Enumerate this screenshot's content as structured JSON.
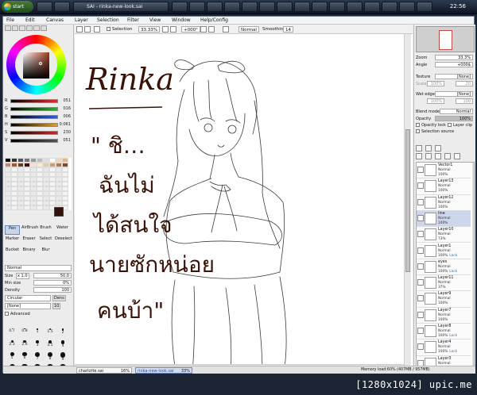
{
  "taskbar": {
    "start_label": "start",
    "active_window": "SAI - rinka-new-look.sai",
    "clock": "22:56"
  },
  "app_title": "SAI",
  "menu": [
    "File",
    "Edit",
    "Canvas",
    "Layer",
    "Selection",
    "Filter",
    "View",
    "Window",
    "Help/Config"
  ],
  "canvas_toolbar": {
    "selection_label": "Selection",
    "zoom": "33.33%",
    "rotation": "+000°",
    "mode": "Normal",
    "smoothing_label": "Smoothing",
    "smoothing": "14"
  },
  "color_sliders": [
    {
      "label": "R",
      "value": "051",
      "color": "#e03030"
    },
    {
      "label": "G",
      "value": "016",
      "color": "#30b030"
    },
    {
      "label": "B",
      "value": "006",
      "color": "#3060e0"
    },
    {
      "label": "H",
      "value": "0:061",
      "color": "#e0a030"
    },
    {
      "label": "S",
      "value": "230",
      "color": "#c03030"
    },
    {
      "label": "V",
      "value": "051",
      "color": "#555555"
    }
  ],
  "fg_color": "#33100a",
  "tools": [
    "Pen",
    "AirBrush",
    "Brush",
    "Water",
    "Marker",
    "Eraser",
    "Select",
    "Deselect",
    "Bucket",
    "Binary",
    "Blur"
  ],
  "selected_tool": "Pen",
  "tool_settings": {
    "mode": "Normal",
    "size_label": "Size",
    "size_mult": "x 1.0",
    "size": "50.0",
    "min_size_label": "Min size",
    "min_size": "0%",
    "density_label": "Density",
    "density": "100",
    "shape": "Circular",
    "shape_value": "Dens",
    "shape_value2": "10",
    "texture": "[None]",
    "advanced_label": "Advanced"
  },
  "brush_sizes": [
    "0.7",
    "0.8",
    "1",
    "1.5",
    "2",
    "2.3",
    "2.6",
    "3",
    "3.5",
    "4",
    "5",
    "6",
    "7",
    "8",
    "9",
    "10",
    "12",
    "14",
    "16",
    "20",
    "25",
    "30",
    "35",
    "40",
    "50"
  ],
  "navigator": {
    "zoom_label": "Zoom",
    "zoom": "33.3%",
    "angle_label": "Angle",
    "angle": "+000$"
  },
  "texture_panel": {
    "texture_label": "Texture",
    "texture": "[None]",
    "scale_label": "Scale",
    "scale": "100%",
    "strength": "20",
    "wet_label": "Wet edge",
    "wet": "[None]",
    "wet_scale": "100%",
    "wet_strength": "100"
  },
  "layer_props": {
    "blend_label": "Blend mode",
    "blend": "Normal",
    "opacity_label": "Opacity",
    "opacity": "100%",
    "opacity_lock_label": "Opacity lock",
    "clip_label": "Layer clip",
    "selection_source_label": "Selection source"
  },
  "layers": [
    {
      "name": "Vector1",
      "mode": "Normal",
      "opacity": "100%",
      "lock": ""
    },
    {
      "name": "Layer13",
      "mode": "Normal",
      "opacity": "100%",
      "lock": ""
    },
    {
      "name": "Layer12",
      "mode": "Normal",
      "opacity": "100%",
      "lock": ""
    },
    {
      "name": "line",
      "mode": "Normal",
      "opacity": "100%",
      "lock": ""
    },
    {
      "name": "Layer10",
      "mode": "Normal",
      "opacity": "73%",
      "lock": ""
    },
    {
      "name": "Layer1",
      "mode": "Normal",
      "opacity": "100%",
      "lock": "Lock"
    },
    {
      "name": "eyes",
      "mode": "Normal",
      "opacity": "100%",
      "lock": "Lock"
    },
    {
      "name": "Layer11",
      "mode": "Normal",
      "opacity": "37%",
      "lock": ""
    },
    {
      "name": "Layer9",
      "mode": "Normal",
      "opacity": "100%",
      "lock": ""
    },
    {
      "name": "Layer7",
      "mode": "Normal",
      "opacity": "100%",
      "lock": ""
    },
    {
      "name": "Layer8",
      "mode": "Normal",
      "opacity": "100%",
      "lock": "Lock"
    },
    {
      "name": "Layer4",
      "mode": "Normal",
      "opacity": "100%",
      "lock": "Lock"
    },
    {
      "name": "Layer3",
      "mode": "Normal",
      "opacity": "100%",
      "lock": ""
    }
  ],
  "selected_layer": "line",
  "canvas_text": {
    "title": "Rinka",
    "line1": "\" ชิ…",
    "line2": "ฉันไม่",
    "line3": "ได้สนใจ",
    "line4": "นายซักหน่อย",
    "line5": "คนบ้า\""
  },
  "status": {
    "file1": "charlotte.sai",
    "file1_zoom": "16%",
    "file2": "rinka-new-look.sai",
    "file2_zoom": "33%",
    "memory": "Memory load:60% (407MB / 957MB)"
  },
  "credit": "[1280x1024] upic.me"
}
